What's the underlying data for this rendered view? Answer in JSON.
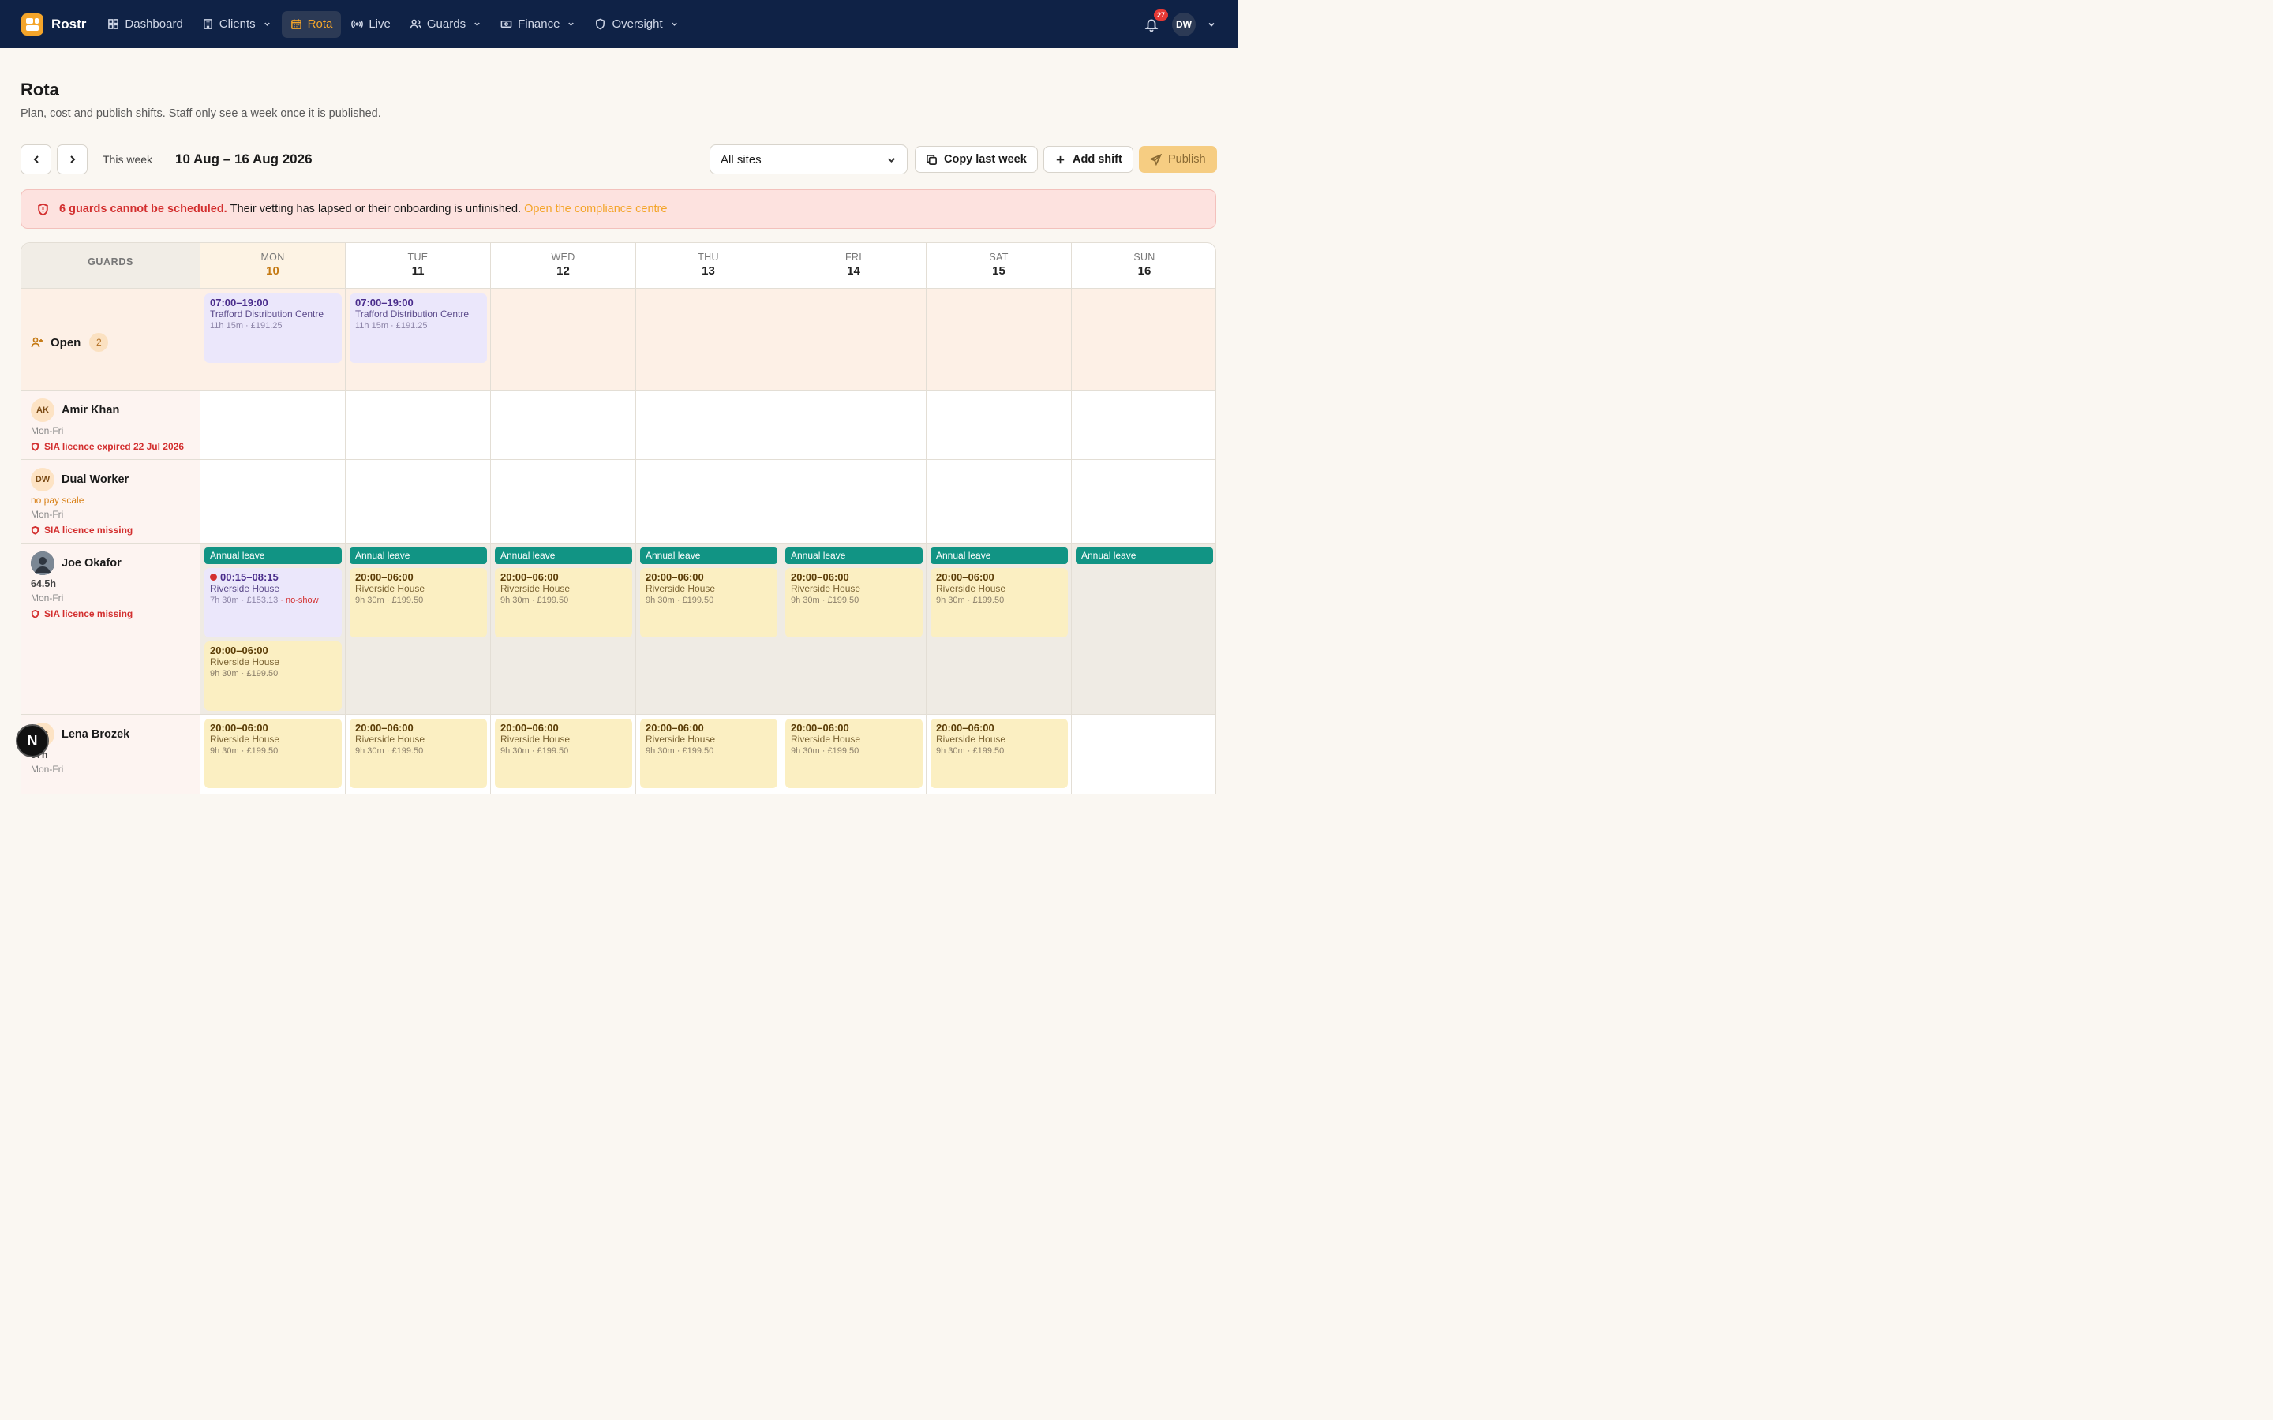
{
  "nav": {
    "brand": "Rostr",
    "items": [
      {
        "label": "Dashboard"
      },
      {
        "label": "Clients"
      },
      {
        "label": "Rota"
      },
      {
        "label": "Live"
      },
      {
        "label": "Guards"
      },
      {
        "label": "Finance"
      },
      {
        "label": "Oversight"
      }
    ],
    "notifications": "27",
    "user_initials": "DW"
  },
  "header": {
    "title": "Rota",
    "subtitle": "Plan, cost and publish shifts. Staff only see a week once it is published."
  },
  "toolbar": {
    "this_week": "This week",
    "range": "10 Aug – 16 Aug 2026",
    "site_select": "All sites",
    "copy_label": "Copy last week",
    "add_label": "Add shift",
    "publish_label": "Publish"
  },
  "alert": {
    "strong": "6 guards cannot be scheduled.",
    "text": "Their vetting has lapsed or their onboarding is unfinished.",
    "link": "Open the compliance centre"
  },
  "grid": {
    "guards_header": "GUARDS",
    "days": [
      {
        "dow": "MON",
        "num": "10"
      },
      {
        "dow": "TUE",
        "num": "11"
      },
      {
        "dow": "WED",
        "num": "12"
      },
      {
        "dow": "THU",
        "num": "13"
      },
      {
        "dow": "FRI",
        "num": "14"
      },
      {
        "dow": "SAT",
        "num": "15"
      },
      {
        "dow": "SUN",
        "num": "16"
      }
    ],
    "open": {
      "label": "Open",
      "count": "2"
    },
    "leave_label": "Annual leave",
    "guards": [
      {
        "initials": "AK",
        "name": "Amir Khan",
        "pattern": "Mon-Fri",
        "warning": "SIA licence expired 22 Jul 2026"
      },
      {
        "initials": "DW",
        "name": "Dual Worker",
        "payscale": "no pay scale",
        "pattern": "Mon-Fri",
        "warning": "SIA licence missing"
      },
      {
        "name": "Joe Okafor",
        "hours": "64.5h",
        "pattern": "Mon-Fri",
        "warning": "SIA licence missing"
      },
      {
        "initials": "LB",
        "name": "Lena Brozek",
        "hours": "57h",
        "pattern": "Mon-Fri"
      }
    ],
    "shifts": {
      "open_time": "07:00–19:00",
      "open_site": "Trafford Distribution Centre",
      "open_cost": "11h 15m  · £191.25",
      "night_time": "20:00–06:00",
      "night_site": "Riverside House",
      "night_cost": "9h 30m  · £199.50",
      "joe_mon_time": "00:15–08:15",
      "joe_mon_site": "Riverside House",
      "joe_mon_cost": "7h 30m  · £153.13",
      "joe_mon_flag": "no-show"
    }
  },
  "fab": "N"
}
